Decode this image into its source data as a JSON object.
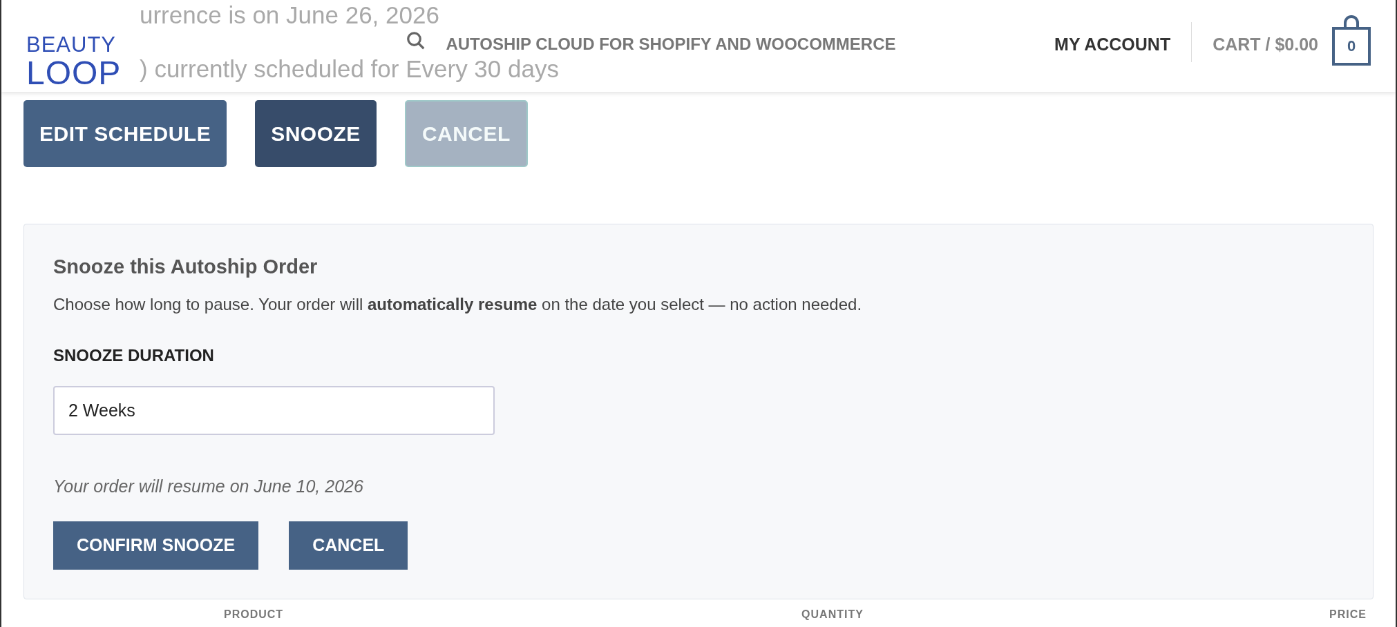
{
  "background_lines": [
    "urrence is on June 26, 2026",
    ") currently scheduled for Every 30 days"
  ],
  "header": {
    "logo": {
      "top": "BEAUTY",
      "bottom": "LOOP"
    },
    "search_label": "AUTOSHIP CLOUD FOR SHOPIFY AND WOOCOMMERCE",
    "account": "MY ACCOUNT",
    "cart": "CART / $0.00",
    "cart_count": "0"
  },
  "actions": [
    {
      "label": "EDIT SCHEDULE",
      "kind": "primary"
    },
    {
      "label": "SNOOZE",
      "kind": "active"
    },
    {
      "label": "CANCEL",
      "kind": "disabled"
    }
  ],
  "snooze_panel": {
    "title": "Snooze this Autoship Order",
    "description": "Choose how long to pause. Your order will **automatically resume** on the date you select — no action needed.",
    "field_label": "SNOOZE DURATION",
    "duration": {
      "value": "2 Weeks"
    },
    "note": "Your order will resume on June 10, 2026",
    "buttons": [
      "CONFIRM SNOOZE",
      "CANCEL"
    ]
  },
  "table": {
    "columns": [
      "PRODUCT",
      "QUANTITY",
      "PRICE"
    ]
  }
}
